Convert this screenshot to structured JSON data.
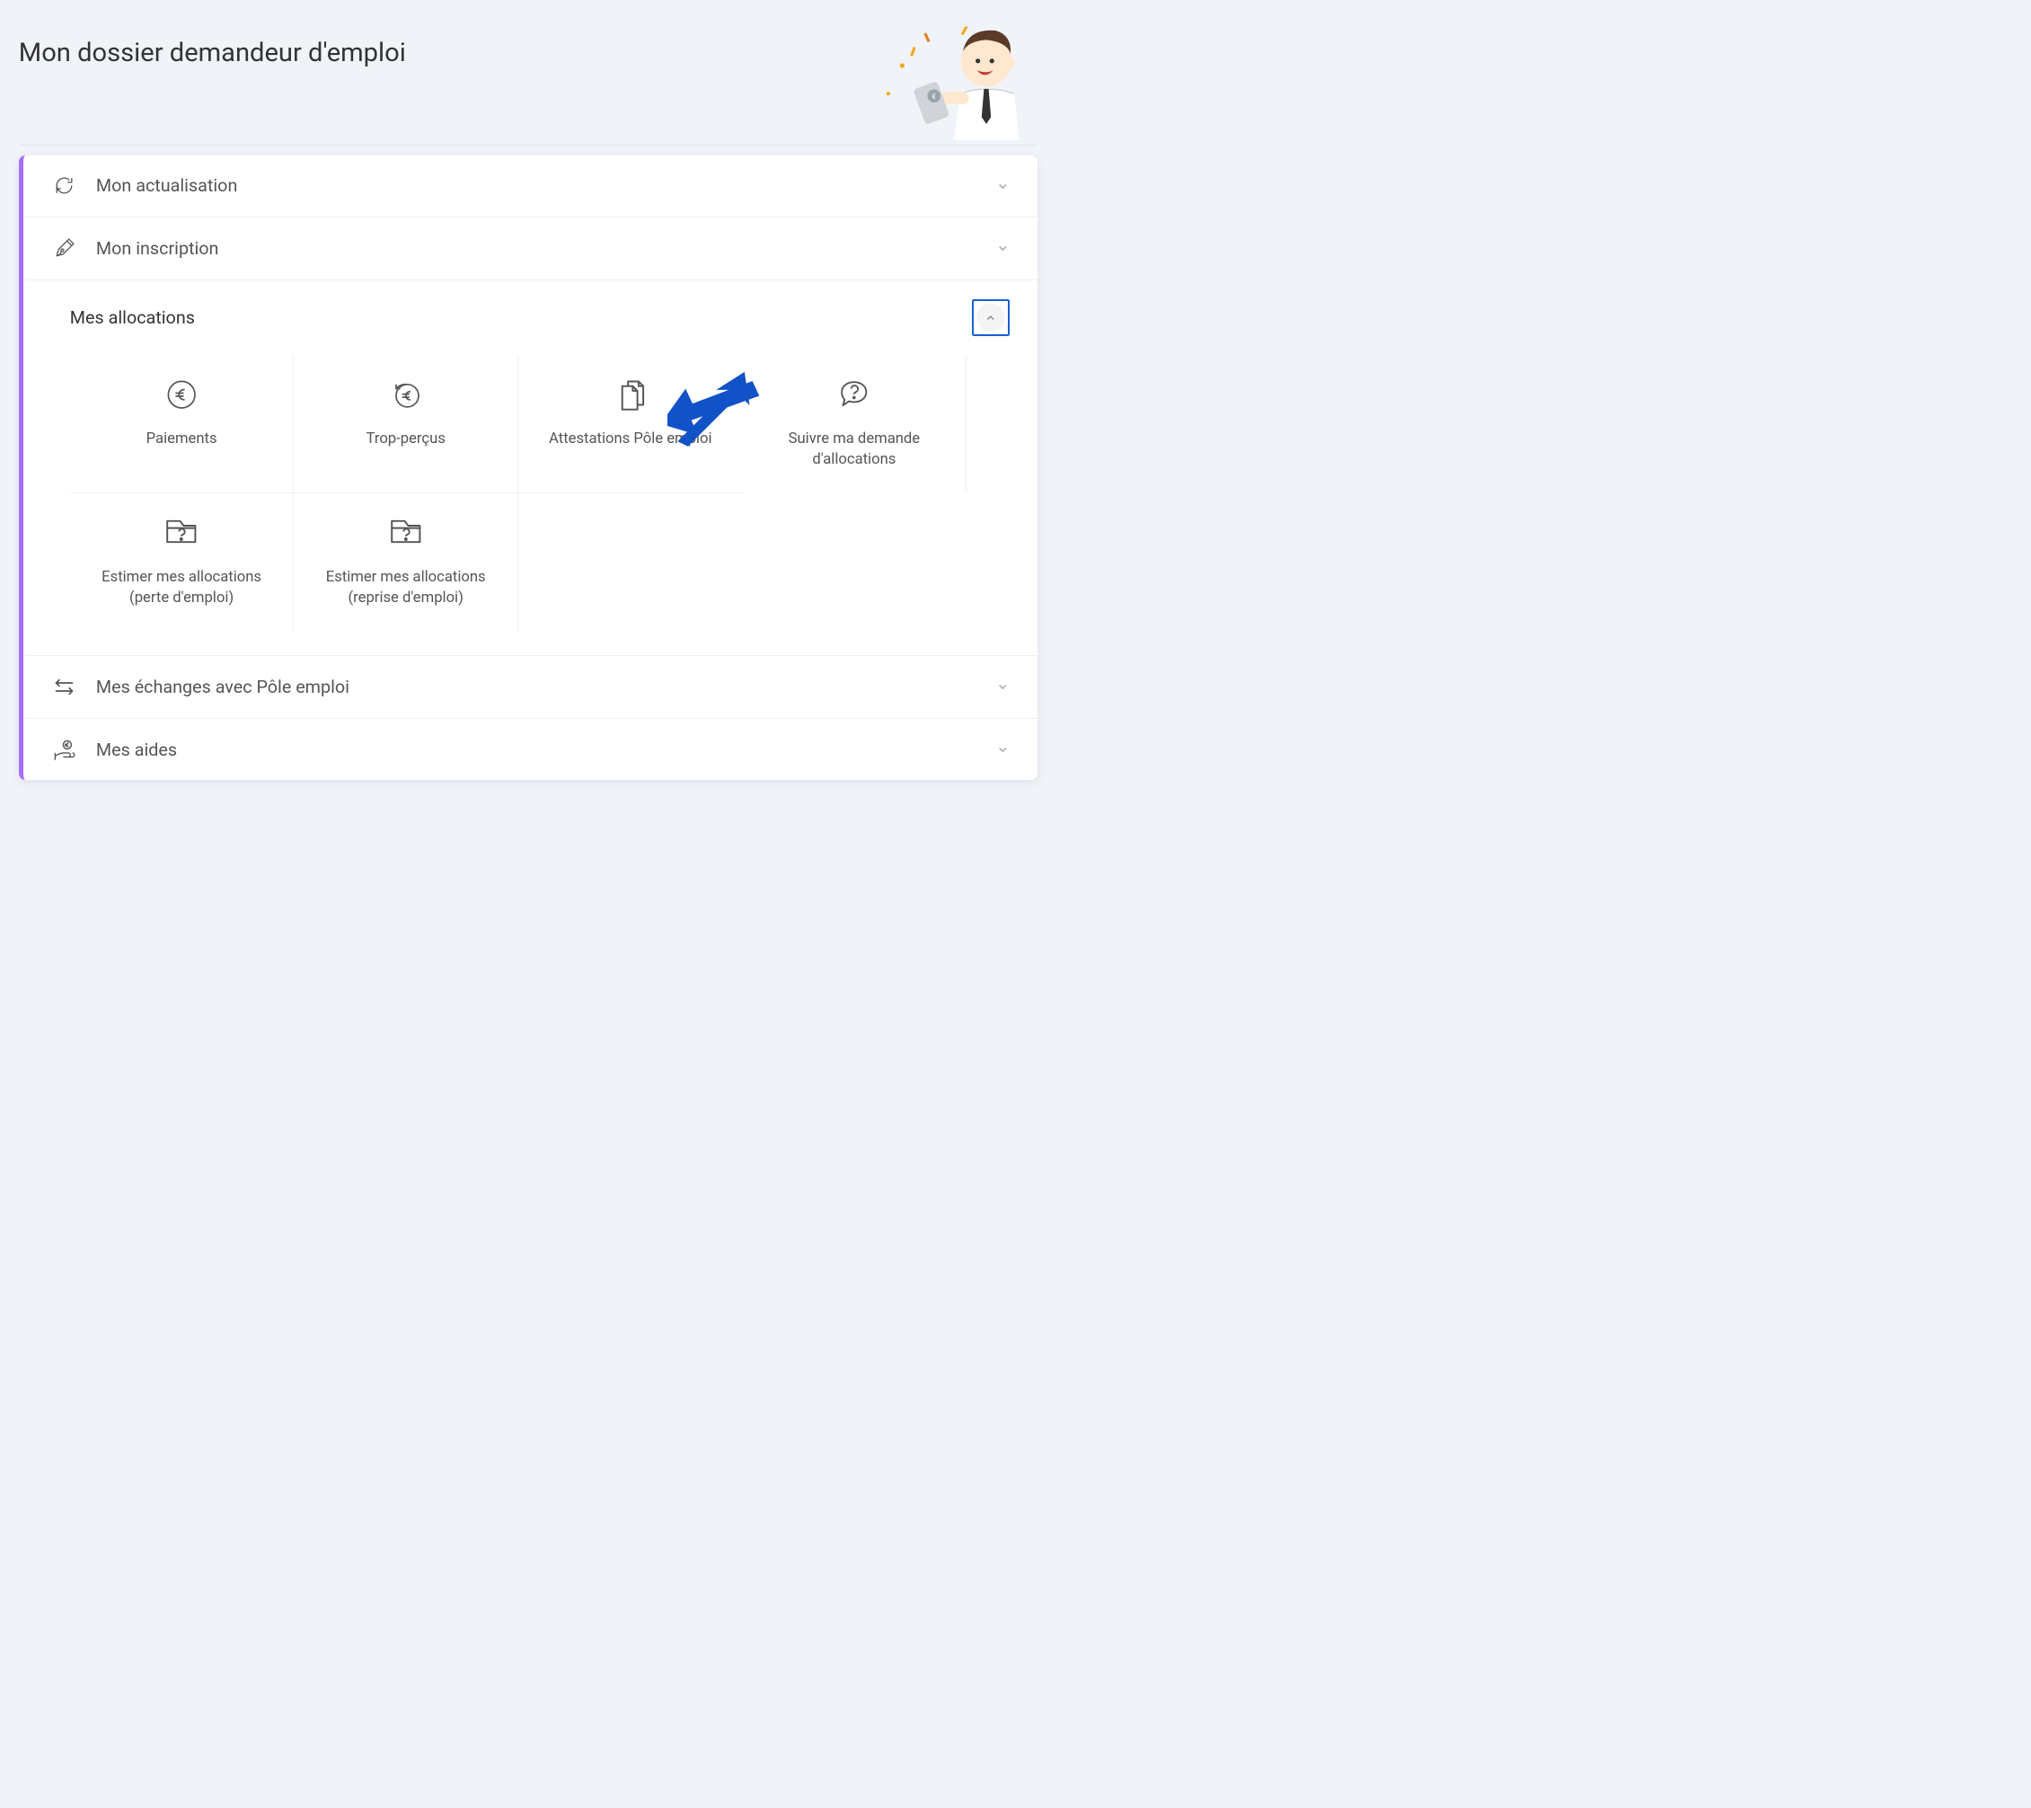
{
  "header": {
    "title": "Mon dossier demandeur d'emploi"
  },
  "colors": {
    "accent": "#a56eff",
    "arrow": "#1152c9",
    "borderFocus": "#1a5fd6"
  },
  "sections": [
    {
      "id": "actualisation",
      "label": "Mon actualisation",
      "icon": "refresh-icon",
      "expanded": false
    },
    {
      "id": "inscription",
      "label": "Mon inscription",
      "icon": "pen-icon",
      "expanded": false
    },
    {
      "id": "allocations",
      "label": "Mes allocations",
      "icon": null,
      "expanded": true
    },
    {
      "id": "echanges",
      "label": "Mes échanges avec Pôle emploi",
      "icon": "exchange-icon",
      "expanded": false
    },
    {
      "id": "aides",
      "label": "Mes aides",
      "icon": "hand-coin-icon",
      "expanded": false
    }
  ],
  "allocations": {
    "title": "Mes allocations",
    "tiles": [
      {
        "id": "paiements",
        "label": "Paiements",
        "icon": "euro-circle-icon"
      },
      {
        "id": "trop-percus",
        "label": "Trop-perçus",
        "icon": "refund-icon"
      },
      {
        "id": "attestations",
        "label": "Attestations Pôle emploi",
        "icon": "documents-icon"
      },
      {
        "id": "suivre-demande",
        "label": "Suivre ma demande d'allocations",
        "icon": "speech-question-icon"
      },
      {
        "id": "estimer-perte",
        "label": "Estimer mes allocations (perte d'emploi)",
        "icon": "folder-question-icon"
      },
      {
        "id": "estimer-reprise",
        "label": "Estimer mes allocations (reprise d'emploi)",
        "icon": "folder-question-icon"
      }
    ]
  }
}
